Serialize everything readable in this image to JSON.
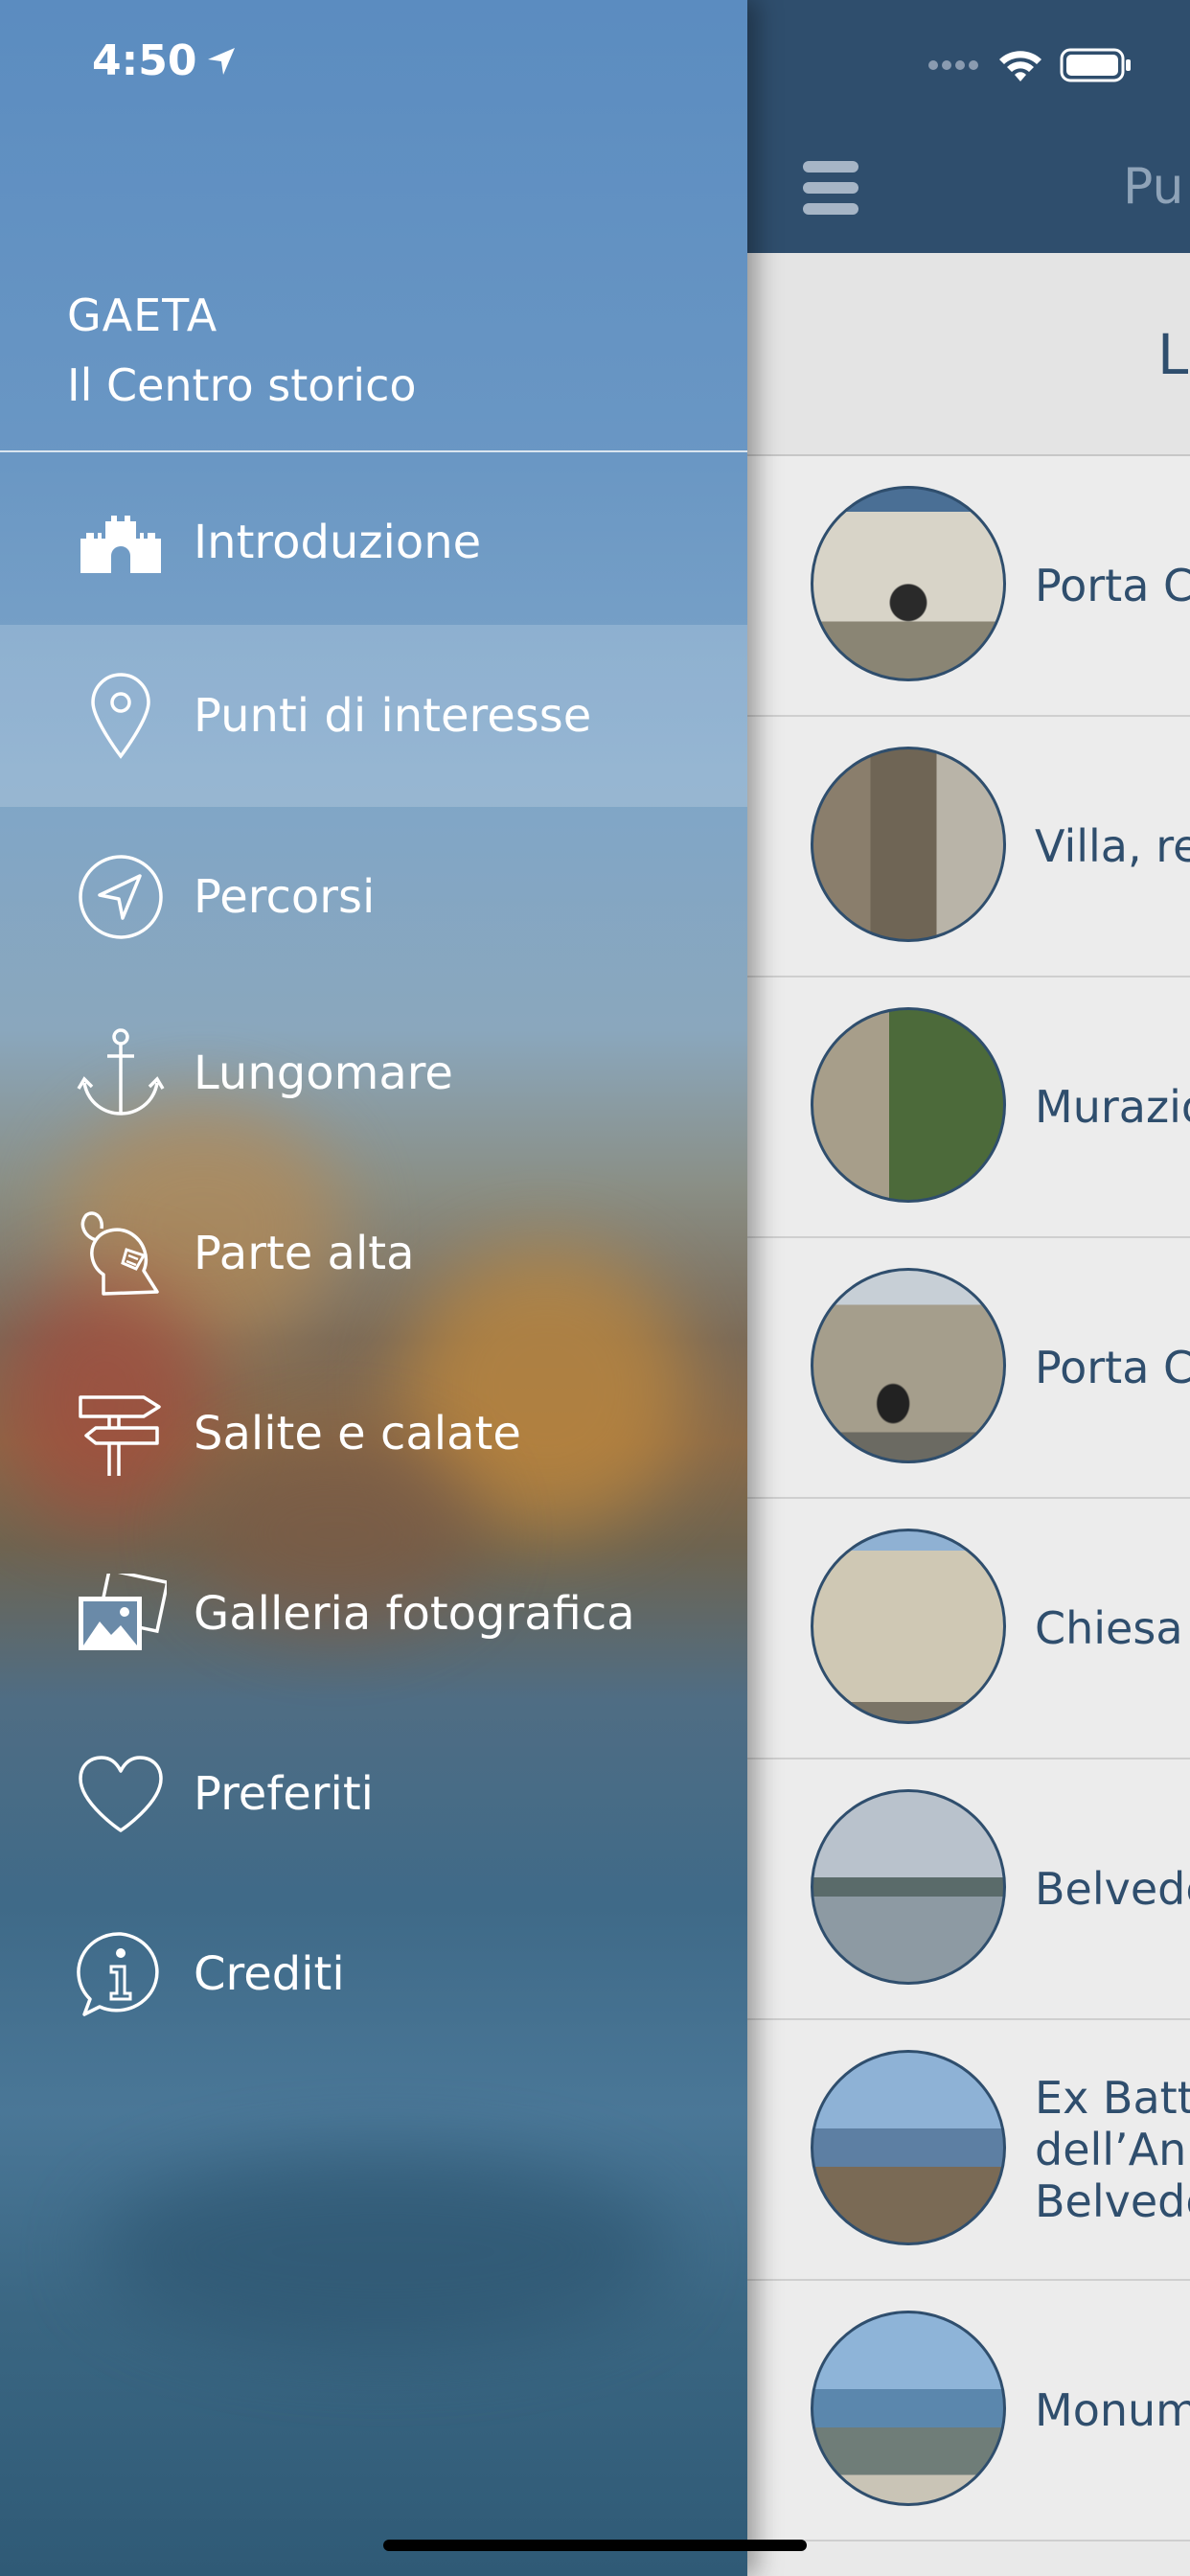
{
  "status_bar": {
    "time": "4:50",
    "location_icon": "location-arrow-icon",
    "signal_icon": "cellular-signal-icon",
    "wifi_icon": "wifi-icon",
    "battery_icon": "battery-icon"
  },
  "drawer": {
    "app_name": "GAETA",
    "app_subtitle": "Il Centro storico",
    "items": [
      {
        "label": "Introduzione",
        "icon": "castle-icon",
        "active": false
      },
      {
        "label": "Punti di interesse",
        "icon": "map-pin-icon",
        "active": true
      },
      {
        "label": "Percorsi",
        "icon": "navigation-arrow-icon",
        "active": false
      },
      {
        "label": "Lungomare",
        "icon": "anchor-icon",
        "active": false
      },
      {
        "label": "Parte alta",
        "icon": "knight-helmet-icon",
        "active": false
      },
      {
        "label": "Salite e calate",
        "icon": "signpost-icon",
        "active": false
      },
      {
        "label": "Galleria fotografica",
        "icon": "photo-gallery-icon",
        "active": false
      },
      {
        "label": "Preferiti",
        "icon": "heart-icon",
        "active": false
      },
      {
        "label": "Crediti",
        "icon": "info-bubble-icon",
        "active": false
      }
    ]
  },
  "main": {
    "menu_icon": "hamburger-menu-icon",
    "title": "Pu",
    "subheader": "L",
    "poi_list": [
      {
        "label": "Porta C"
      },
      {
        "label": "Villa, re"
      },
      {
        "label": "Murazio"
      },
      {
        "label": "Porta C"
      },
      {
        "label": "Chiesa"
      },
      {
        "label": "Belvede"
      },
      {
        "label": "Ex Batt\ndell’An\nBelvede"
      },
      {
        "label": "Monum"
      }
    ]
  },
  "colors": {
    "header": "#2f4e6d",
    "accent": "#2f4e6d",
    "list_bg": "#ececec",
    "drawer_text": "#ffffff"
  }
}
